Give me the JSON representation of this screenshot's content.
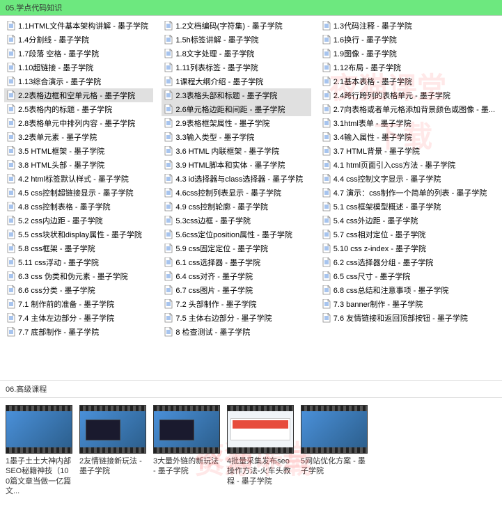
{
  "section1": {
    "title": "05.学点代码知识",
    "watermarks": [
      "夜猫课堂",
      "下载"
    ],
    "columns": [
      [
        {
          "t": "1.1HTML文件基本架构讲解 - 墨子学院",
          "h": false
        },
        {
          "t": "1.4分割线 - 墨子学院",
          "h": false
        },
        {
          "t": "1.7段落 空格 - 墨子学院",
          "h": false
        },
        {
          "t": "1.10超链接 - 墨子学院",
          "h": false
        },
        {
          "t": "1.13综合演示 - 墨子学院",
          "h": false
        },
        {
          "t": "2.2表格边框和空单元格 - 墨子学院",
          "h": true
        },
        {
          "t": "2.5表格内的标题 - 墨子学院",
          "h": false
        },
        {
          "t": "2.8表格单元中排列内容 - 墨子学院",
          "h": false
        },
        {
          "t": "3.2表单元素 - 墨子学院",
          "h": false
        },
        {
          "t": "3.5 HTML框架 - 墨子学院",
          "h": false
        },
        {
          "t": "3.8 HTML头部 - 墨子学院",
          "h": false
        },
        {
          "t": "4.2 html标签默认样式 - 墨子学院",
          "h": false
        },
        {
          "t": "4.5 css控制超链接显示 - 墨子学院",
          "h": false
        },
        {
          "t": "4.8 css控制表格 - 墨子学院",
          "h": false
        },
        {
          "t": "5.2 css内边距 - 墨子学院",
          "h": false
        },
        {
          "t": "5.5 css块状和display属性 - 墨子学院",
          "h": false
        },
        {
          "t": "5.8 css框架 - 墨子学院",
          "h": false
        },
        {
          "t": "5.11 css浮动 - 墨子学院",
          "h": false
        },
        {
          "t": "6.3 css 伪类和伪元素 - 墨子学院",
          "h": false
        },
        {
          "t": "6.6 css分类 - 墨子学院",
          "h": false
        },
        {
          "t": "7.1 制作前的准备 - 墨子学院",
          "h": false
        },
        {
          "t": "7.4 主体左边部分 - 墨子学院",
          "h": false
        },
        {
          "t": "7.7 底部制作 - 墨子学院",
          "h": false
        }
      ],
      [
        {
          "t": "1.2文档编码(字符集) - 墨子学院",
          "h": false
        },
        {
          "t": "1.5h标签讲解 - 墨子学院",
          "h": false
        },
        {
          "t": "1.8文字处理 - 墨子学院",
          "h": false
        },
        {
          "t": "1.11列表标签 - 墨子学院",
          "h": false
        },
        {
          "t": "1课程大纲介绍 - 墨子学院",
          "h": false
        },
        {
          "t": "2.3表格头部和标题 - 墨子学院",
          "h": true
        },
        {
          "t": "2.6单元格边距和间距 - 墨子学院",
          "h": true
        },
        {
          "t": "2.9表格框架属性 - 墨子学院",
          "h": false
        },
        {
          "t": "3.3输入类型 - 墨子学院",
          "h": false
        },
        {
          "t": "3.6 HTML 内联框架 - 墨子学院",
          "h": false
        },
        {
          "t": "3.9 HTML脚本和实体 - 墨子学院",
          "h": false
        },
        {
          "t": "4.3 id选择器与class选择器 - 墨子学院",
          "h": false
        },
        {
          "t": "4.6css控制列表显示 - 墨子学院",
          "h": false
        },
        {
          "t": "4.9 css控制轮廓 - 墨子学院",
          "h": false
        },
        {
          "t": "5.3css边框 - 墨子学院",
          "h": false
        },
        {
          "t": "5.6css定位position属性 - 墨子学院",
          "h": false
        },
        {
          "t": "5.9 css固定定位 - 墨子学院",
          "h": false
        },
        {
          "t": "6.1 css选择器 - 墨子学院",
          "h": false
        },
        {
          "t": "6.4 css对齐 - 墨子学院",
          "h": false
        },
        {
          "t": "6.7 css图片 - 墨子学院",
          "h": false
        },
        {
          "t": "7.2 头部制作 - 墨子学院",
          "h": false
        },
        {
          "t": "7.5 主体右边部分 - 墨子学院",
          "h": false
        },
        {
          "t": "8 检查测试 - 墨子学院",
          "h": false
        }
      ],
      [
        {
          "t": "1.3代码注释 - 墨子学院",
          "h": false
        },
        {
          "t": "1.6换行 - 墨子学院",
          "h": false
        },
        {
          "t": "1.9图像 - 墨子学院",
          "h": false
        },
        {
          "t": "1.12布局 - 墨子学院",
          "h": false
        },
        {
          "t": "2.1基本表格 - 墨子学院",
          "h": false
        },
        {
          "t": "2.4跨行跨列的表格单元 - 墨子学院",
          "h": false
        },
        {
          "t": "2.7向表格或者单元格添加背景颜色或图像 - 墨...",
          "h": false
        },
        {
          "t": "3.1html表单 - 墨子学院",
          "h": false
        },
        {
          "t": "3.4输入属性 - 墨子学院",
          "h": false
        },
        {
          "t": "3.7 HTML背景 - 墨子学院",
          "h": false
        },
        {
          "t": "4.1 html页面引入css方法 - 墨子学院",
          "h": false
        },
        {
          "t": "4.4 css控制文字显示 - 墨子学院",
          "h": false
        },
        {
          "t": "4.7 演示：css制作一个简单的列表 - 墨子学院",
          "h": false
        },
        {
          "t": "5.1 css框架模型概述 - 墨子学院",
          "h": false
        },
        {
          "t": "5.4 css外边距 - 墨子学院",
          "h": false
        },
        {
          "t": "5.7 css相对定位 - 墨子学院",
          "h": false
        },
        {
          "t": "5.10 css z-index - 墨子学院",
          "h": false
        },
        {
          "t": "6.2 css选择器分组 - 墨子学院",
          "h": false
        },
        {
          "t": "6.5 css尺寸 - 墨子学院",
          "h": false
        },
        {
          "t": "6.8 css总结和注意事项 - 墨子学院",
          "h": false
        },
        {
          "t": "7.3 banner制作 - 墨子学院",
          "h": false
        },
        {
          "t": "7.6 友情链接和返回顶部按钮 - 墨子学院",
          "h": false
        }
      ]
    ]
  },
  "section2": {
    "title": "06.高级课程",
    "watermarks": [
      "夜猫课堂",
      "资源下载"
    ],
    "videos": [
      {
        "title": "1墨子土土大神内部SEO秘籍神技（100篇文章当做一亿篇文...",
        "thumb": "desktop"
      },
      {
        "title": "2友情链接新玩法 - 墨子学院",
        "thumb": "window"
      },
      {
        "title": "3大量外链的新玩法 - 墨子学院",
        "thumb": "window"
      },
      {
        "title": "4批量采集发布seo操作方法-火车头教程 - 墨子学院",
        "thumb": "browser"
      },
      {
        "title": "5网站优化方案 - 墨子学院",
        "thumb": "desktop"
      }
    ]
  }
}
